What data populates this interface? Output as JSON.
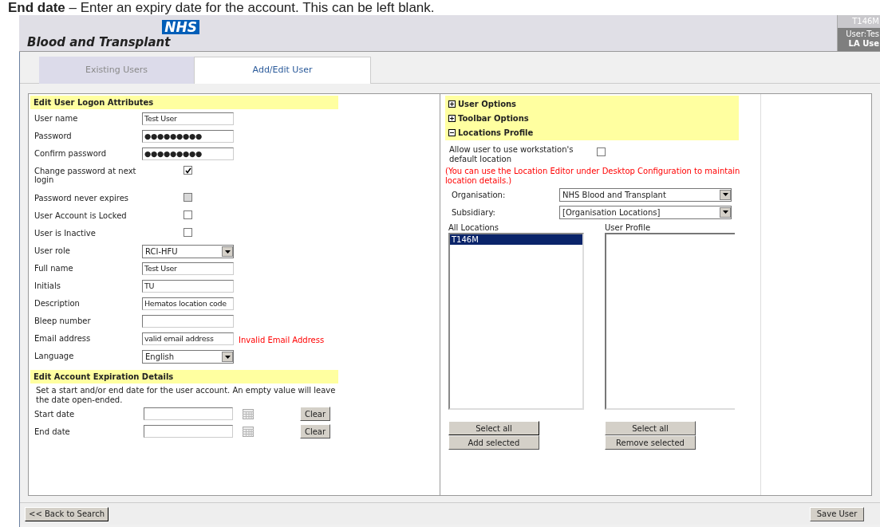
{
  "caption": {
    "bold": "End date",
    "rest": " – Enter an expiry date for the account. This can be left blank."
  },
  "header": {
    "logo_badge": "NHS",
    "logo_name": "Blood and Transplant",
    "location": "T146M",
    "user": "User:Tes",
    "role": "LA Use"
  },
  "tabs": [
    {
      "label": "Existing Users",
      "selected": false
    },
    {
      "label": "Add/Edit User",
      "selected": true
    }
  ],
  "logon_section": {
    "title": "Edit User Logon Attributes",
    "fields": [
      {
        "label": "User name",
        "kind": "text",
        "value": "Test User"
      },
      {
        "label": "Password",
        "kind": "text",
        "value": "●●●●●●●●●"
      },
      {
        "label": "Confirm password",
        "kind": "text",
        "value": "●●●●●●●●●"
      },
      {
        "label": "Change password at next login",
        "kind": "checkbox",
        "checked": true,
        "disabled": false
      },
      {
        "label": "Password never expires",
        "kind": "checkbox",
        "checked": false,
        "disabled": true
      },
      {
        "label": "User Account is Locked",
        "kind": "checkbox",
        "checked": false,
        "disabled": false
      },
      {
        "label": "User is Inactive",
        "kind": "checkbox",
        "checked": false,
        "disabled": false
      },
      {
        "label": "User role",
        "kind": "select",
        "value": "RCI-HFU"
      },
      {
        "label": "Full name",
        "kind": "text",
        "value": "Test User"
      },
      {
        "label": "Initials",
        "kind": "text",
        "value": "TU"
      },
      {
        "label": "Description",
        "kind": "text",
        "value": "Hematos location code"
      },
      {
        "label": "Bleep number",
        "kind": "text"
      },
      {
        "label": "Email address",
        "kind": "text",
        "value": "valid email address",
        "error": "Invalid Email Address"
      },
      {
        "label": "Language",
        "kind": "select",
        "value": "English"
      }
    ]
  },
  "expiration_section": {
    "title": "Edit Account Expiration Details",
    "note": "Set a start and/or end date for the user account. An empty value will leave the date open-ended.",
    "dates": [
      {
        "label": "Start date",
        "button": "Clear"
      },
      {
        "label": "End date",
        "button": "Clear"
      }
    ]
  },
  "option_groups": [
    {
      "label": "User Options",
      "expanded": false
    },
    {
      "label": "Toolbar Options",
      "expanded": false
    },
    {
      "label": "Locations Profile",
      "expanded": true
    }
  ],
  "default_location": {
    "label": "Allow user to use workstation's default location",
    "checked": false
  },
  "location_hint": "(You can use the Location Editor under Desktop Configuration to maintain location details.)",
  "location_selects": [
    {
      "label": "Organisation:",
      "value": "NHS Blood and Transplant"
    },
    {
      "label": "Subsidiary:",
      "value": "[Organisation Locations]"
    }
  ],
  "all_locations": {
    "label": "All Locations",
    "items": [
      {
        "text": "T146M",
        "selected": true
      }
    ],
    "buttons": [
      "Select all",
      "Add selected"
    ]
  },
  "user_profile": {
    "label": "User Profile",
    "buttons": [
      "Select all",
      "Remove selected"
    ]
  },
  "footer": {
    "back_button": "<< Back to Search",
    "save_button": "Save User"
  }
}
